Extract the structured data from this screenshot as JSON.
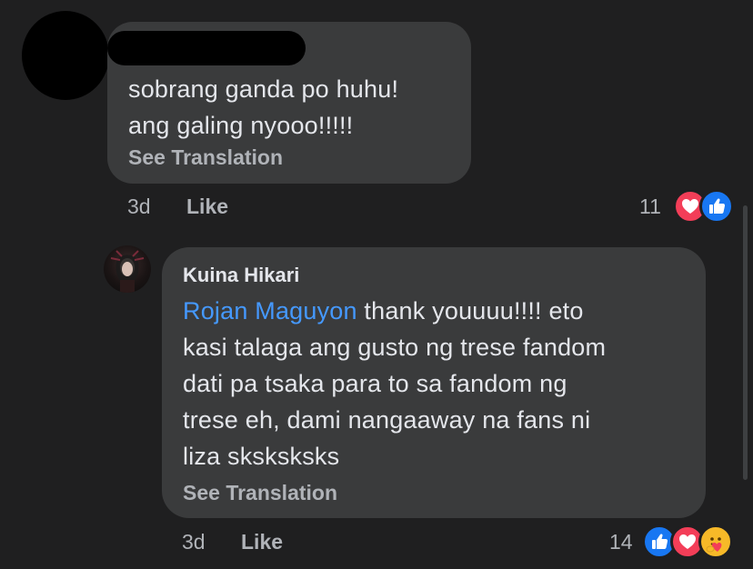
{
  "comment1": {
    "lines": [
      "sobrang ganda po huhu!",
      "ang galing nyooo!!!!!"
    ],
    "see_translation": "See Translation",
    "time": "3d",
    "like_label": "Like",
    "reaction_count": "11",
    "reactions": [
      "love-icon",
      "like-icon"
    ]
  },
  "reply": {
    "author": "Kuina Hikari",
    "mention": "Rojan Maguyon",
    "line1_rest": " thank youuuu!!!! eto",
    "lines": [
      "kasi talaga ang gusto ng trese fandom",
      "dati pa tsaka para to sa fandom ng",
      "trese eh, dami nangaaway na fans ni",
      "liza sksksksks"
    ],
    "see_translation": "See Translation",
    "time": "3d",
    "like_label": "Like",
    "reaction_count": "14",
    "reactions": [
      "like-icon",
      "love-icon",
      "care-icon"
    ]
  },
  "colors": {
    "background": "#1f1f20",
    "bubble": "#3a3b3c",
    "mention": "#4599ff",
    "secondary_text": "#b0b3b8",
    "like_blue": "#1877f2",
    "love_red": "#f33e58",
    "care_yellow": "#f7b928"
  }
}
